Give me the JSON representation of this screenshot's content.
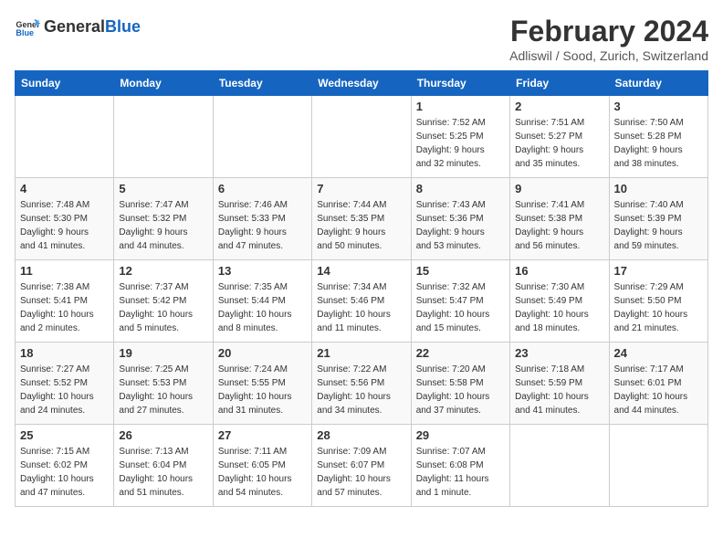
{
  "header": {
    "logo_general": "General",
    "logo_blue": "Blue",
    "month_title": "February 2024",
    "location": "Adliswil / Sood, Zurich, Switzerland"
  },
  "days_of_week": [
    "Sunday",
    "Monday",
    "Tuesday",
    "Wednesday",
    "Thursday",
    "Friday",
    "Saturday"
  ],
  "weeks": [
    [
      {
        "day": "",
        "info": ""
      },
      {
        "day": "",
        "info": ""
      },
      {
        "day": "",
        "info": ""
      },
      {
        "day": "",
        "info": ""
      },
      {
        "day": "1",
        "info": "Sunrise: 7:52 AM\nSunset: 5:25 PM\nDaylight: 9 hours\nand 32 minutes."
      },
      {
        "day": "2",
        "info": "Sunrise: 7:51 AM\nSunset: 5:27 PM\nDaylight: 9 hours\nand 35 minutes."
      },
      {
        "day": "3",
        "info": "Sunrise: 7:50 AM\nSunset: 5:28 PM\nDaylight: 9 hours\nand 38 minutes."
      }
    ],
    [
      {
        "day": "4",
        "info": "Sunrise: 7:48 AM\nSunset: 5:30 PM\nDaylight: 9 hours\nand 41 minutes."
      },
      {
        "day": "5",
        "info": "Sunrise: 7:47 AM\nSunset: 5:32 PM\nDaylight: 9 hours\nand 44 minutes."
      },
      {
        "day": "6",
        "info": "Sunrise: 7:46 AM\nSunset: 5:33 PM\nDaylight: 9 hours\nand 47 minutes."
      },
      {
        "day": "7",
        "info": "Sunrise: 7:44 AM\nSunset: 5:35 PM\nDaylight: 9 hours\nand 50 minutes."
      },
      {
        "day": "8",
        "info": "Sunrise: 7:43 AM\nSunset: 5:36 PM\nDaylight: 9 hours\nand 53 minutes."
      },
      {
        "day": "9",
        "info": "Sunrise: 7:41 AM\nSunset: 5:38 PM\nDaylight: 9 hours\nand 56 minutes."
      },
      {
        "day": "10",
        "info": "Sunrise: 7:40 AM\nSunset: 5:39 PM\nDaylight: 9 hours\nand 59 minutes."
      }
    ],
    [
      {
        "day": "11",
        "info": "Sunrise: 7:38 AM\nSunset: 5:41 PM\nDaylight: 10 hours\nand 2 minutes."
      },
      {
        "day": "12",
        "info": "Sunrise: 7:37 AM\nSunset: 5:42 PM\nDaylight: 10 hours\nand 5 minutes."
      },
      {
        "day": "13",
        "info": "Sunrise: 7:35 AM\nSunset: 5:44 PM\nDaylight: 10 hours\nand 8 minutes."
      },
      {
        "day": "14",
        "info": "Sunrise: 7:34 AM\nSunset: 5:46 PM\nDaylight: 10 hours\nand 11 minutes."
      },
      {
        "day": "15",
        "info": "Sunrise: 7:32 AM\nSunset: 5:47 PM\nDaylight: 10 hours\nand 15 minutes."
      },
      {
        "day": "16",
        "info": "Sunrise: 7:30 AM\nSunset: 5:49 PM\nDaylight: 10 hours\nand 18 minutes."
      },
      {
        "day": "17",
        "info": "Sunrise: 7:29 AM\nSunset: 5:50 PM\nDaylight: 10 hours\nand 21 minutes."
      }
    ],
    [
      {
        "day": "18",
        "info": "Sunrise: 7:27 AM\nSunset: 5:52 PM\nDaylight: 10 hours\nand 24 minutes."
      },
      {
        "day": "19",
        "info": "Sunrise: 7:25 AM\nSunset: 5:53 PM\nDaylight: 10 hours\nand 27 minutes."
      },
      {
        "day": "20",
        "info": "Sunrise: 7:24 AM\nSunset: 5:55 PM\nDaylight: 10 hours\nand 31 minutes."
      },
      {
        "day": "21",
        "info": "Sunrise: 7:22 AM\nSunset: 5:56 PM\nDaylight: 10 hours\nand 34 minutes."
      },
      {
        "day": "22",
        "info": "Sunrise: 7:20 AM\nSunset: 5:58 PM\nDaylight: 10 hours\nand 37 minutes."
      },
      {
        "day": "23",
        "info": "Sunrise: 7:18 AM\nSunset: 5:59 PM\nDaylight: 10 hours\nand 41 minutes."
      },
      {
        "day": "24",
        "info": "Sunrise: 7:17 AM\nSunset: 6:01 PM\nDaylight: 10 hours\nand 44 minutes."
      }
    ],
    [
      {
        "day": "25",
        "info": "Sunrise: 7:15 AM\nSunset: 6:02 PM\nDaylight: 10 hours\nand 47 minutes."
      },
      {
        "day": "26",
        "info": "Sunrise: 7:13 AM\nSunset: 6:04 PM\nDaylight: 10 hours\nand 51 minutes."
      },
      {
        "day": "27",
        "info": "Sunrise: 7:11 AM\nSunset: 6:05 PM\nDaylight: 10 hours\nand 54 minutes."
      },
      {
        "day": "28",
        "info": "Sunrise: 7:09 AM\nSunset: 6:07 PM\nDaylight: 10 hours\nand 57 minutes."
      },
      {
        "day": "29",
        "info": "Sunrise: 7:07 AM\nSunset: 6:08 PM\nDaylight: 11 hours\nand 1 minute."
      },
      {
        "day": "",
        "info": ""
      },
      {
        "day": "",
        "info": ""
      }
    ]
  ]
}
